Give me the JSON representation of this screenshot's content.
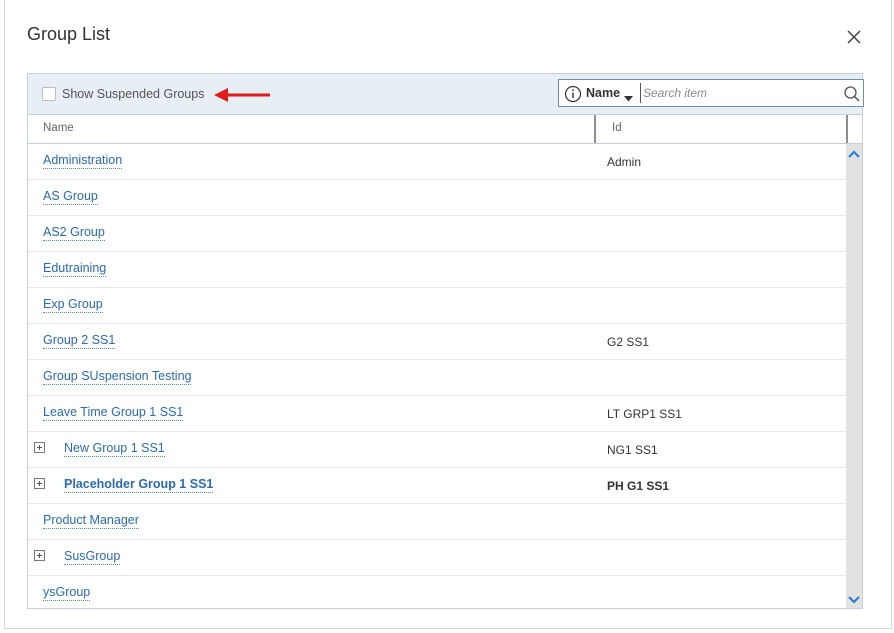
{
  "dialog": {
    "title": "Group List"
  },
  "toolbar": {
    "show_suspended_label": "Show Suspended Groups",
    "show_suspended_checked": false,
    "search_field": "Name",
    "search_placeholder": "Search item"
  },
  "columns": {
    "name": "Name",
    "id": "Id"
  },
  "groups": [
    {
      "name": "Administration",
      "id": "Admin"
    },
    {
      "name": "AS Group",
      "id": ""
    },
    {
      "name": "AS2 Group",
      "id": ""
    },
    {
      "name": "Edutraining",
      "id": ""
    },
    {
      "name": "Exp Group",
      "id": ""
    },
    {
      "name": "Group 2 SS1",
      "id": "G2 SS1"
    },
    {
      "name": "Group SUspension Testing",
      "id": ""
    },
    {
      "name": "Leave Time Group 1 SS1",
      "id": "LT GRP1 SS1"
    },
    {
      "name": "New Group 1 SS1",
      "id": "NG1 SS1",
      "expandable": true
    },
    {
      "name": "Placeholder Group 1 SS1",
      "id": "PH G1 SS1",
      "expandable": true,
      "bold": true
    },
    {
      "name": "Product Manager",
      "id": ""
    },
    {
      "name": "SusGroup",
      "id": "",
      "expandable": true
    },
    {
      "name": "ysGroup",
      "id": ""
    }
  ],
  "colors": {
    "link": "#2a6ab4",
    "toolbar_bg": "#e7eff5",
    "annotation_arrow": "#e01b1b",
    "scroll_arrow": "#2a7fd4"
  },
  "icons": {
    "close": "close-icon",
    "info": "info-icon",
    "search": "search-icon",
    "expand": "expand-plus-icon",
    "scroll_up": "chevron-up-icon",
    "scroll_down": "chevron-down-icon"
  }
}
